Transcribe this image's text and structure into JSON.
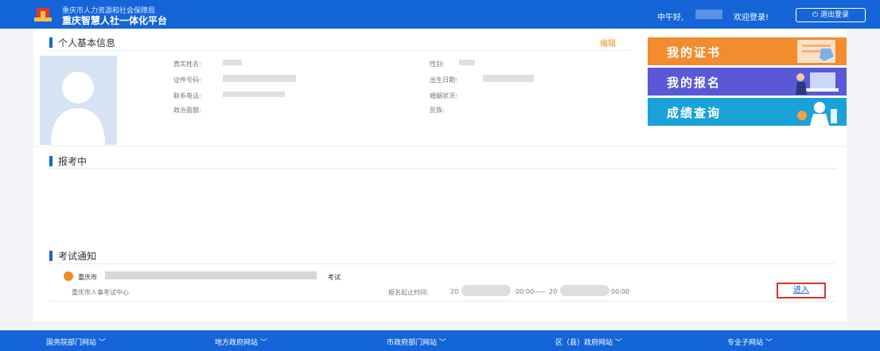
{
  "header": {
    "sub_title": "重庆市人力资源和社会保障局",
    "title": "重庆智慧人社一体化平台",
    "greeting": "中午好,",
    "welcome": "欢迎登录!",
    "logout_label": "退出登录",
    "colors": {
      "primary": "#1565d8"
    }
  },
  "profile": {
    "section_title": "个人基本信息",
    "edit_label": "编辑",
    "fields": {
      "real_name": "真实姓名:",
      "gender": "性别:",
      "id_number": "证件号码:",
      "birthdate": "出生日期:",
      "phone": "联系电话:",
      "marital": "婚姻状况:",
      "political": "政治面貌:",
      "ethnicity": "民族:"
    }
  },
  "quick_links": [
    {
      "label": "我的证书",
      "color": "#f28c2f",
      "icon": "certificate-icon"
    },
    {
      "label": "我的报名",
      "color": "#5a58d6",
      "icon": "signup-icon"
    },
    {
      "label": "成绩查询",
      "color": "#1aa2d8",
      "icon": "score-icon"
    }
  ],
  "applying": {
    "section_title": "报考中"
  },
  "notice": {
    "section_title": "考试通知",
    "city": "重庆市",
    "exam_suffix": "考试",
    "org": "重庆市人事考试中心",
    "period_label": "报名起止时间:",
    "start_prefix": "20",
    "start_time": "00:00",
    "separator": "——",
    "end_prefix": "20",
    "end_time": "00:00",
    "enter_label": "进入"
  },
  "footer": {
    "items": [
      "国务院部门网站",
      "地方政府网站",
      "市政府部门网站",
      "区（县）政府网站",
      "专业子网站"
    ]
  }
}
